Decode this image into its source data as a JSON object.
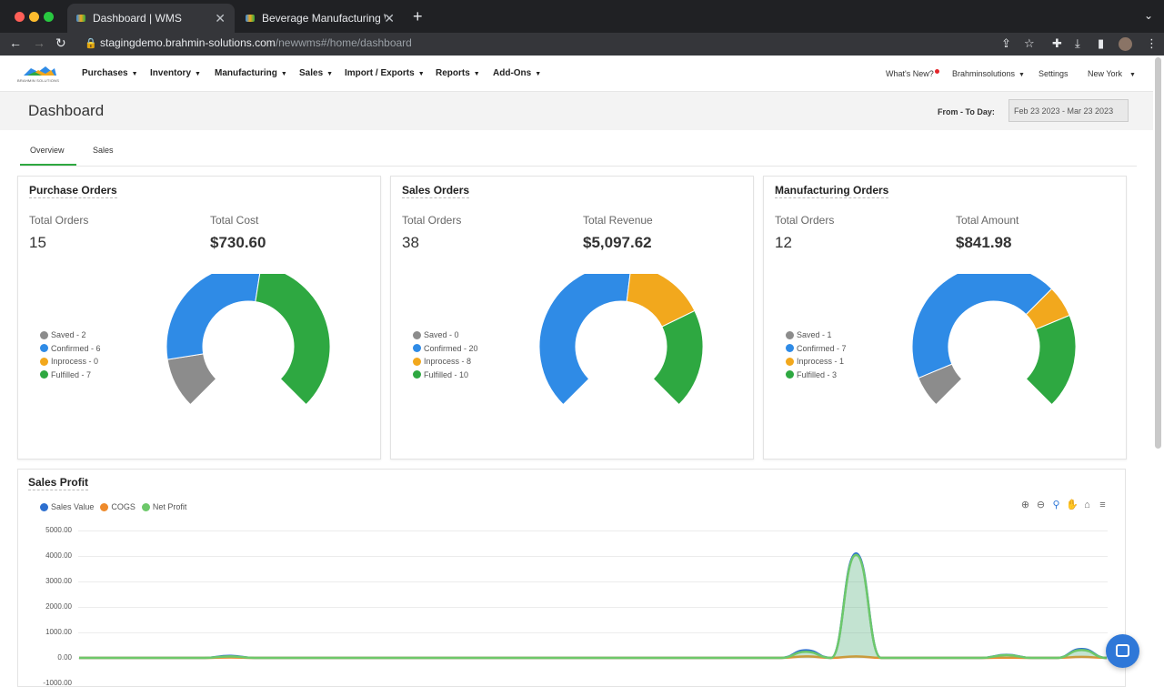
{
  "browser": {
    "tabs": [
      {
        "title": "Dashboard | WMS",
        "active": true
      },
      {
        "title": "Beverage Manufacturing Workf",
        "active": false
      }
    ],
    "url_host": "stagingdemo.brahmin-solutions.com",
    "url_path": "/newwms#/home/dashboard"
  },
  "nav": {
    "logo_text": "BRAHMIN SOLUTIONS",
    "items": [
      "Purchases",
      "Inventory",
      "Manufacturing",
      "Sales",
      "Import / Exports",
      "Reports",
      "Add-Ons"
    ],
    "whats_new": "What's New?",
    "account": "Brahminsolutions",
    "settings": "Settings",
    "location": "New York"
  },
  "header": {
    "title": "Dashboard",
    "from_label": "From - To Day:",
    "date_range": "Feb 23 2023 - Mar 23 2023"
  },
  "tabs": [
    "Overview",
    "Sales"
  ],
  "colors": {
    "saved": "#8c8c8c",
    "confirmed": "#2f8be6",
    "inprocess": "#f2a81d",
    "fulfilled": "#2ea841"
  },
  "cards": [
    {
      "title": "Purchase Orders",
      "label1": "Total Orders",
      "value1": "15",
      "label2": "Total Cost",
      "value2": "$730.60",
      "legend": [
        "Saved - 2",
        "Confirmed - 6",
        "Inprocess - 0",
        "Fulfilled - 7"
      ],
      "counts": [
        2,
        6,
        0,
        7
      ]
    },
    {
      "title": "Sales Orders",
      "label1": "Total Orders",
      "value1": "38",
      "label2": "Total Revenue",
      "value2": "$5,097.62",
      "legend": [
        "Saved - 0",
        "Confirmed - 20",
        "Inprocess - 8",
        "Fulfilled - 10"
      ],
      "counts": [
        0,
        20,
        8,
        10
      ]
    },
    {
      "title": "Manufacturing Orders",
      "label1": "Total Orders",
      "value1": "12",
      "label2": "Total Amount",
      "value2": "$841.98",
      "legend": [
        "Saved - 1",
        "Confirmed - 7",
        "Inprocess - 1",
        "Fulfilled - 3"
      ],
      "counts": [
        1,
        7,
        1,
        3
      ]
    }
  ],
  "profit": {
    "title": "Sales Profit",
    "legend": [
      {
        "name": "Sales Value",
        "color": "#2d6fcf"
      },
      {
        "name": "COGS",
        "color": "#ee8a2b"
      },
      {
        "name": "Net Profit",
        "color": "#6dc86a"
      }
    ],
    "tools": [
      "zoom-in-icon",
      "zoom-out-icon",
      "zoom-select-icon",
      "pan-icon",
      "home-icon",
      "menu-icon"
    ],
    "yticks": [
      "5000.00",
      "4000.00",
      "3000.00",
      "2000.00",
      "1000.00",
      "0.00",
      "-1000.00"
    ]
  },
  "chart_data": {
    "type": "area",
    "series": [
      {
        "name": "Sales Value",
        "values": [
          0,
          0,
          0,
          0,
          0,
          0,
          80,
          0,
          0,
          0,
          0,
          0,
          0,
          0,
          0,
          0,
          0,
          0,
          0,
          0,
          0,
          0,
          0,
          0,
          0,
          0,
          0,
          0,
          0,
          300,
          0,
          4100,
          0,
          0,
          0,
          0,
          0,
          120,
          0,
          0,
          350,
          0
        ]
      },
      {
        "name": "COGS",
        "values": [
          0,
          0,
          0,
          0,
          0,
          0,
          20,
          0,
          0,
          0,
          0,
          0,
          0,
          0,
          0,
          0,
          0,
          0,
          0,
          0,
          0,
          0,
          0,
          0,
          0,
          0,
          0,
          0,
          0,
          60,
          0,
          60,
          0,
          0,
          0,
          0,
          0,
          10,
          0,
          0,
          40,
          0
        ]
      },
      {
        "name": "Net Profit",
        "values": [
          0,
          0,
          0,
          0,
          0,
          0,
          60,
          0,
          0,
          0,
          0,
          0,
          0,
          0,
          0,
          0,
          0,
          0,
          0,
          0,
          0,
          0,
          0,
          0,
          0,
          0,
          0,
          0,
          0,
          240,
          0,
          4040,
          0,
          0,
          0,
          0,
          0,
          110,
          0,
          0,
          310,
          0
        ]
      }
    ],
    "ylim": [
      -1000,
      5000
    ]
  }
}
